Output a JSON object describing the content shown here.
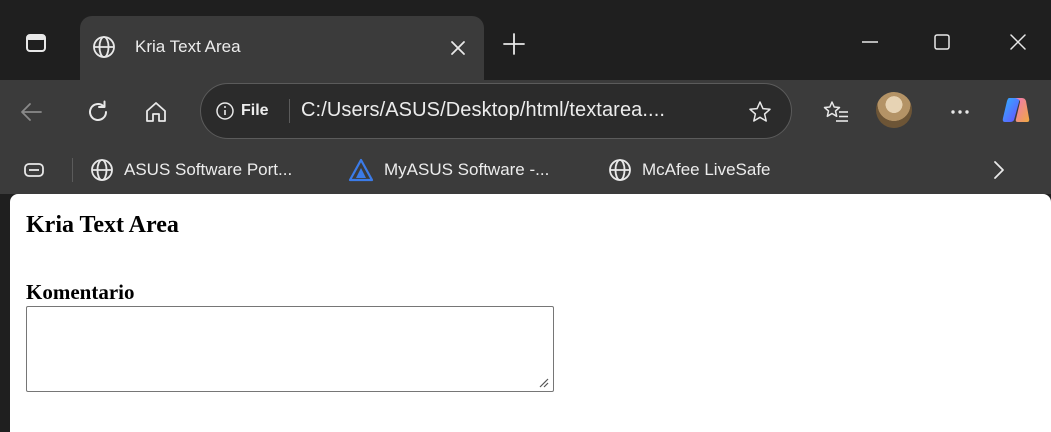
{
  "tab": {
    "title": "Kria Text Area"
  },
  "omnibox": {
    "site_info_label": "File",
    "url": "C:/Users/ASUS/Desktop/html/textarea...."
  },
  "bookmarks": [
    {
      "label": "ASUS Software Port...",
      "icon": "globe-icon"
    },
    {
      "label": "MyASUS Software -...",
      "icon": "myasus-logo-icon"
    },
    {
      "label": "McAfee LiveSafe",
      "icon": "globe-icon"
    }
  ],
  "page": {
    "heading": "Kria Text Area",
    "label": "Komentario",
    "textarea_value": ""
  },
  "colors": {
    "chrome_dark": "#1f1f1f",
    "chrome_toolbar": "#3b3b3b",
    "page_bg": "#ffffff",
    "myasus_accent": "#3b7be8"
  }
}
